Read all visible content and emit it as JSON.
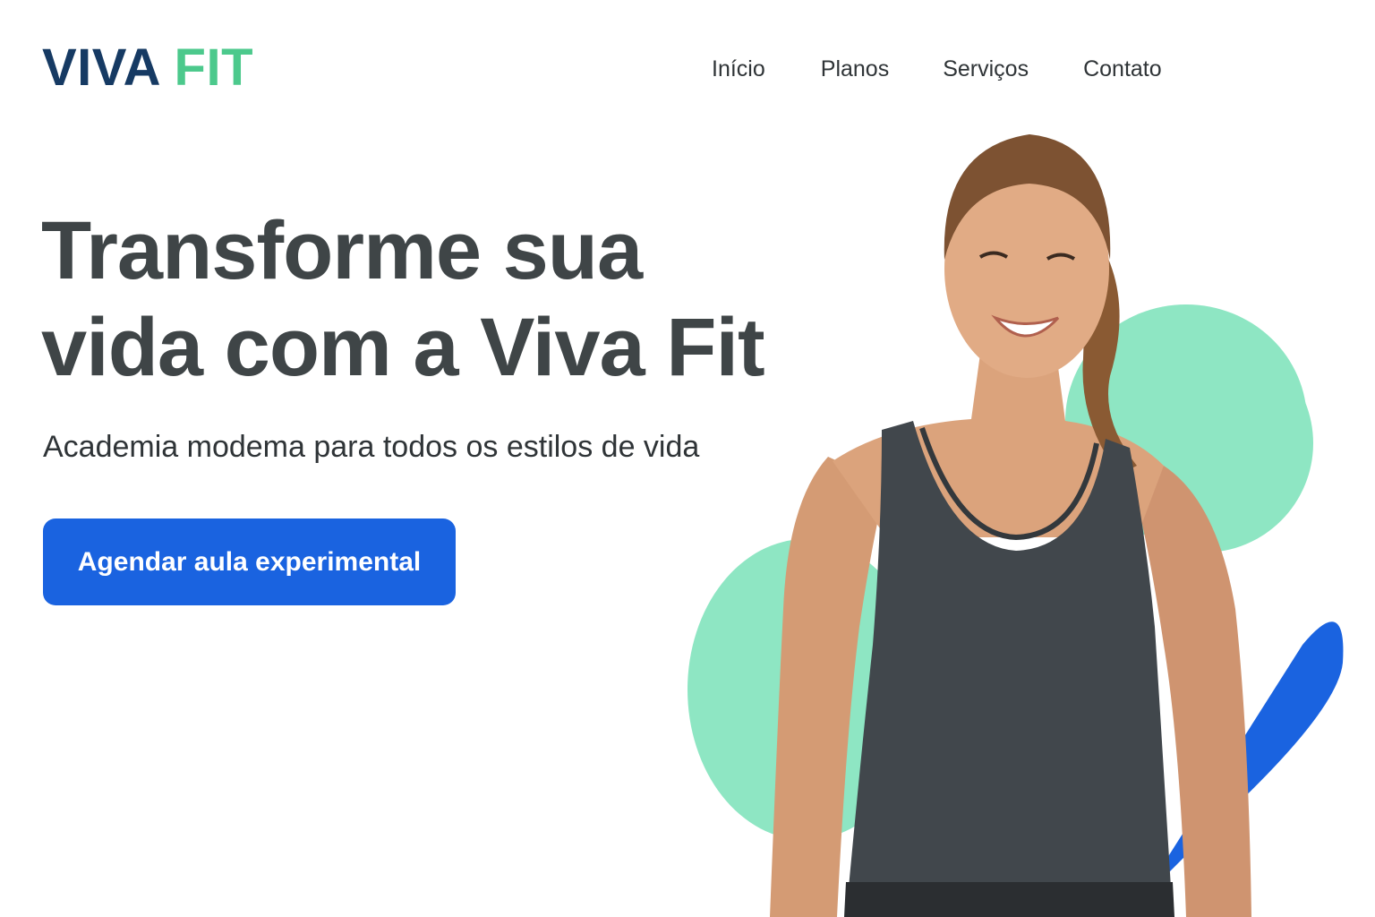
{
  "brand": {
    "word1": "VIVA",
    "word2": "FIT"
  },
  "nav": {
    "items": [
      "Início",
      "Planos",
      "Serviços",
      "Contato"
    ]
  },
  "hero": {
    "headline_line1": "Transforme sua",
    "headline_line2": "vida com a Viva Fit",
    "subtitle": "Academia modema para todos os estilos de vida",
    "cta_label": "Agendar aula experimental"
  },
  "colors": {
    "brand_dark": "#163a63",
    "brand_green": "#4cc98c",
    "accent_blue": "#1a63e0",
    "shape_green": "#8ee6c3",
    "text": "#3f4547"
  }
}
